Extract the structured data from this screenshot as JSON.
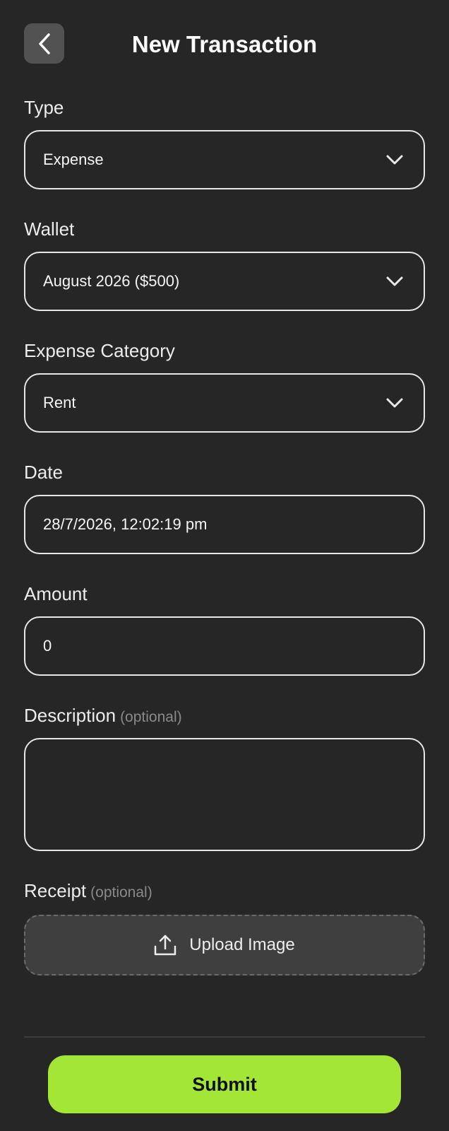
{
  "header": {
    "title": "New Transaction",
    "back_icon": "chevron-left-icon"
  },
  "form": {
    "type": {
      "label": "Type",
      "value": "Expense"
    },
    "wallet": {
      "label": "Wallet",
      "value": "August 2026 ($500)"
    },
    "category": {
      "label": "Expense Category",
      "value": "Rent"
    },
    "date": {
      "label": "Date",
      "value": "28/7/2026, 12:02:19 pm"
    },
    "amount": {
      "label": "Amount",
      "value": "0"
    },
    "description": {
      "label": "Description",
      "optional": "(optional)",
      "value": ""
    },
    "receipt": {
      "label": "Receipt",
      "optional": "(optional)",
      "upload_label": "Upload Image",
      "upload_icon": "upload-icon"
    }
  },
  "footer": {
    "submit_label": "Submit"
  },
  "colors": {
    "background": "#262626",
    "accent": "#a3e635",
    "border": "#e6e6e6"
  }
}
